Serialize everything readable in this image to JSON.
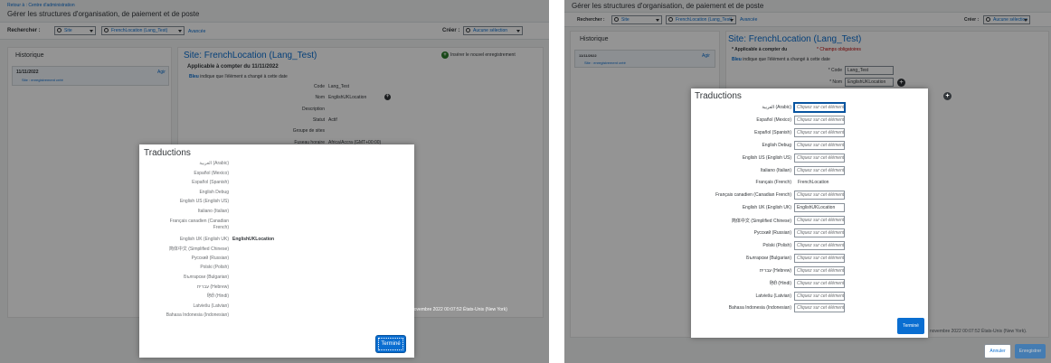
{
  "left": {
    "breadcrumb": "Retour à : Centre d'administration",
    "page_title": "Gérer les structures d'organisation, de paiement et de poste",
    "search_label": "Rechercher :",
    "search_type": "Site",
    "search_value": "FrenchLocation (Lang_Test)",
    "advanced_link": "Avancée",
    "create_label": "Créer :",
    "create_value": "Aucune sélection",
    "history_title": "Historique",
    "history_date": "11/11/2022",
    "history_action": "Agir",
    "history_note": "Site : enregistrement créé",
    "insert_record": "Insérer le nouvel enregistrement",
    "record_title": "Site: FrenchLocation (Lang_Test)",
    "applicable": "Applicable à compter du  11/11/2022",
    "blue_word": "Bleu",
    "blue_note": " indique que l'élément a changé à cette date",
    "fields": [
      {
        "label": "Code",
        "value": "Lang_Test"
      },
      {
        "label": "Nom",
        "value": "EnglishUKLocation"
      },
      {
        "label": "Description",
        "value": ""
      },
      {
        "label": "Statut",
        "value": "Actif"
      },
      {
        "label": "Groupe de sites",
        "value": ""
      },
      {
        "label": "Fuseau horaire",
        "value": "Africa/Accra (GMT+00:00)"
      }
    ],
    "footer_text": "novembre 2022 00:07:52 États-Unis (New York)",
    "dialog": {
      "title": "Traductions",
      "rows": [
        {
          "label": "العربية (Arabic)",
          "value": ""
        },
        {
          "label": "Español (Mexico)",
          "value": ""
        },
        {
          "label": "Español (Spanish)",
          "value": ""
        },
        {
          "label": "English Debug",
          "value": ""
        },
        {
          "label": "English US (English US)",
          "value": ""
        },
        {
          "label": "Italiano (Italian)",
          "value": ""
        },
        {
          "label": "Français canadien (Canadian",
          "label2": "French)",
          "value": ""
        },
        {
          "label": "English UK (English UK)",
          "value": "EnglishUKLocation"
        },
        {
          "label": "简体中文 (Simplified Chinese)",
          "value": ""
        },
        {
          "label": "Русский (Russian)",
          "value": ""
        },
        {
          "label": "Polski (Polish)",
          "value": ""
        },
        {
          "label": "Български (Bulgarian)",
          "value": ""
        },
        {
          "label": "עברית (Hebrew)",
          "value": ""
        },
        {
          "label": "हिंदी (Hindi)",
          "value": ""
        },
        {
          "label": "Latviešu (Latvian)",
          "value": ""
        },
        {
          "label": "Bahasa Indonesia (Indonesian)",
          "value": ""
        }
      ],
      "done_button": "Terminé"
    }
  },
  "right": {
    "page_title": "Gérer les structures d'organisation, de paiement et de poste",
    "search_label": "Rechercher :",
    "search_type": "Site",
    "search_value": "FrenchLocation (Lang_Test)",
    "advanced_link": "Avancée",
    "create_label": "Créer :",
    "create_value": "Aucune sélection",
    "history_title": "Historique",
    "history_date": "11/11/2022",
    "history_action": "Agir",
    "history_note": "Site : enregistrement créé",
    "record_title": "Site: FrenchLocation (Lang_Test)",
    "applicable": "* Applicable à compter du",
    "required": "* Champs obligatoires",
    "blue_word": "Bleu",
    "blue_note": " indique que l'élément a changé à cette date",
    "code_label": "* Code",
    "code_value": "Lang_Test",
    "name_label": "* Nom",
    "name_value": "EnglishUKLocation",
    "footer_text": "novembre 2022 00:07:52 États-Unis (New York).",
    "cancel_button": "Annuler",
    "save_button": "Enregistrer",
    "dialog": {
      "title": "Traductions",
      "placeholder": "Cliquez sur cet élément p",
      "rows": [
        {
          "label": "العربية (Arabic)",
          "value": "",
          "mode": "input"
        },
        {
          "label": "Español (Mexico)",
          "value": "",
          "mode": "input"
        },
        {
          "label": "Español (Spanish)",
          "value": "",
          "mode": "input"
        },
        {
          "label": "English Debug",
          "value": "",
          "mode": "input"
        },
        {
          "label": "English US (English US)",
          "value": "",
          "mode": "input"
        },
        {
          "label": "Italiano (Italian)",
          "value": "",
          "mode": "input"
        },
        {
          "label": "Français (French)",
          "value": "FrenchLocation",
          "mode": "text"
        },
        {
          "label": "Français canadien (Canadian French)",
          "value": "",
          "mode": "input"
        },
        {
          "label": "English UK (English UK)",
          "value": "EnglishUKLocation",
          "mode": "input"
        },
        {
          "label": "简体中文 (Simplified Chinese)",
          "value": "",
          "mode": "input"
        },
        {
          "label": "Русский (Russian)",
          "value": "",
          "mode": "input"
        },
        {
          "label": "Polski (Polish)",
          "value": "",
          "mode": "input"
        },
        {
          "label": "Български (Bulgarian)",
          "value": "",
          "mode": "input"
        },
        {
          "label": "עברית (Hebrew)",
          "value": "",
          "mode": "input"
        },
        {
          "label": "हिंदी (Hindi)",
          "value": "",
          "mode": "input"
        },
        {
          "label": "Latviešu (Latvian)",
          "value": "",
          "mode": "input"
        },
        {
          "label": "Bahasa Indonesia (Indonesian)",
          "value": "",
          "mode": "input"
        }
      ],
      "done_button": "Terminé"
    }
  }
}
